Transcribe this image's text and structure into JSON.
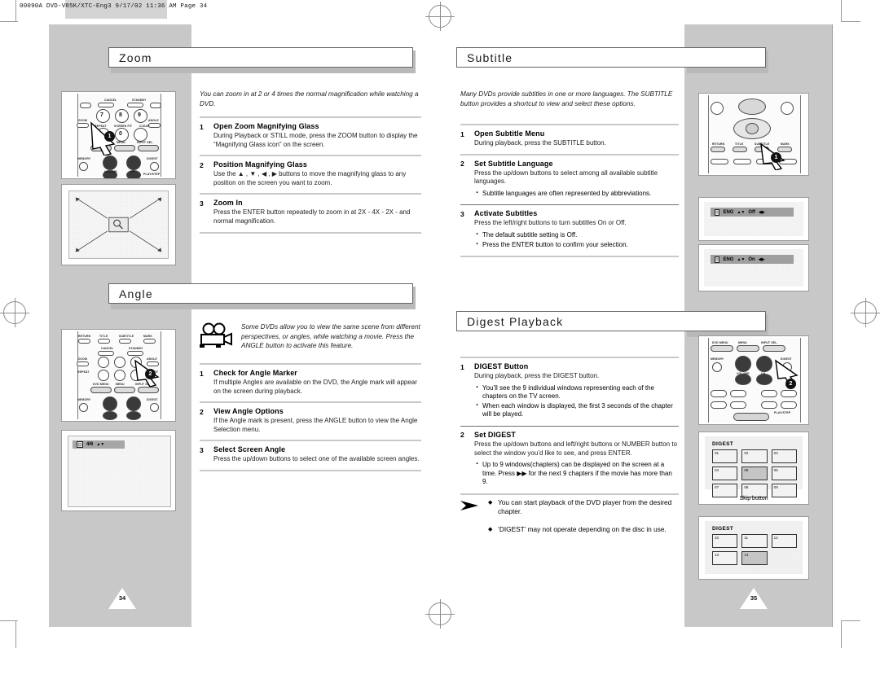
{
  "print_slug": {
    "job": "00090A",
    "file": "DVD-V85K/XTC-Eng3",
    "date": "9/17/02",
    "time": "11:36 AM",
    "page_label": "Page 34",
    "full": "00090A  DVD-V85K/XTC-Eng3   9/17/02 11:36 AM   Page 34"
  },
  "left_page": {
    "page_number": "34",
    "sections": [
      {
        "id": "zoom",
        "title": "Zoom",
        "intro": "You can zoom in at 2 or 4 times the normal magnification while watching a DVD.",
        "steps": [
          {
            "num": "1",
            "header": "Open Zoom Magnifying Glass",
            "text": "During Playback or STILL mode, press the ZOOM button to display the “Magnifying Glass icon” on the screen.",
            "bullets": []
          },
          {
            "num": "2",
            "header": "Position Magnifying Glass",
            "text": "Use the ▲ , ▼ , ◀ , ▶ buttons to move the magnifying glass to any position on the screen you want to zoom.",
            "bullets": []
          },
          {
            "num": "3",
            "header": "Zoom In",
            "text": "Press the ENTER button repeatedly to zoom in at 2X - 4X - 2X - and normal magnification.",
            "bullets": []
          }
        ]
      },
      {
        "id": "angle",
        "title": "Angle",
        "intro": "Some DVDs allow you to view the same scene from different perspectives, or angles, while watching a movie. Press the ANGLE button to activate this feature.",
        "intro_icon": "movie-camera-icon",
        "steps": [
          {
            "num": "1",
            "header": "Check for Angle Marker",
            "text": "If multiple Angles are available on the DVD, the Angle mark will appear on the screen during playback.",
            "bullets": []
          },
          {
            "num": "2",
            "header": "View Angle Options",
            "text": "If the Angle mark is present, press the ANGLE button to view the Angle Selection menu.",
            "bullets": []
          },
          {
            "num": "3",
            "header": "Select Screen Angle",
            "text": "Press the up/down buttons to select one of the available screen angles.",
            "bullets": []
          }
        ]
      }
    ],
    "illustrations": {
      "remote_zoom": {
        "name": "remote-control-zoom",
        "callout": "1",
        "keys_numeric": [
          "7",
          "8",
          "9",
          "0"
        ],
        "labels": [
          "CANCEL",
          "STANDBY",
          "ZOOM",
          "REPEAT",
          "SUBTITLE",
          "SCREEN FIT",
          "CLEAR",
          "ANGLE",
          "DVD MENU",
          "MENU",
          "INPUT SEL.",
          "MEMORY",
          "VOLUME",
          "CH",
          "DIGEST",
          "PLAY/STEP"
        ]
      },
      "zoom_screen": {
        "name": "zoom-magnifier-screen",
        "icon": "magnifying-glass-icon"
      },
      "remote_angle": {
        "name": "remote-control-angle",
        "callout": "2"
      },
      "angle_osd": {
        "name": "angle-osd-screen",
        "icon": "camera-icon",
        "value": "4/6",
        "arrows": "▲▼"
      }
    }
  },
  "right_page": {
    "page_number": "35",
    "sections": [
      {
        "id": "subtitle",
        "title": "Subtitle",
        "intro": "Many DVDs provide subtitles in one or more languages. The SUBTITLE button provides a shortcut to view and select these options.",
        "steps": [
          {
            "num": "1",
            "header": "Open Subtitle Menu",
            "text": "During playback, press the SUBTITLE button.",
            "bullets": []
          },
          {
            "num": "2",
            "header": "Set Subtitle Language",
            "text": "Press the up/down buttons to select among all available subtitle languages.",
            "bullets": [
              "Subtitle languages are often represented by abbreviations."
            ]
          },
          {
            "num": "3",
            "header": "Activate Subtitles",
            "text": "Press the left/right buttons to turn subtitles On or Off.",
            "bullets": [
              "The default subtitle setting is Off.",
              "Press the ENTER button to confirm your selection."
            ]
          }
        ]
      },
      {
        "id": "digest",
        "title": "Digest Playback",
        "intro": "",
        "steps": [
          {
            "num": "1",
            "header": "DIGEST Button",
            "text": "During playback, press the DIGEST button.",
            "bullets": [
              "You’ll see the 9 individual windows representing each of the chapters on the TV screen.",
              "When each window is displayed, the first 3 seconds of the chapter will be played."
            ]
          },
          {
            "num": "2",
            "header": "Set DIGEST",
            "text": "Press the up/down buttons and left/right buttons or NUMBER button to select the window you’d like to see, and press ENTER.",
            "bullets": [
              "Up to 9 windows(chapters) can be displayed on the screen at a time. Press ▶▶ for the next 9 chapters if the movie has more than 9."
            ]
          }
        ],
        "notes": [
          "You can start playback of the DVD player from the desired chapter.",
          "‘DIGEST’ may not operate depending on the disc in use."
        ]
      }
    ],
    "illustrations": {
      "remote_subtitle": {
        "name": "remote-control-subtitle",
        "callout": "1",
        "labels": [
          "RETURN",
          "TITLE",
          "SUBTITLE",
          "MARK"
        ]
      },
      "subtitle_osd_off": {
        "name": "subtitle-osd-off",
        "chip": "≡",
        "lang": "ENG",
        "arrows": "▲▼",
        "state": "Off",
        "lr": "◀▶"
      },
      "subtitle_osd_on": {
        "name": "subtitle-osd-on",
        "chip": "≡",
        "lang": "ENG",
        "arrows": "▲▼",
        "state": "On",
        "lr": "◀▶"
      },
      "remote_digest": {
        "name": "remote-control-digest",
        "callout": "2",
        "labels": [
          "DVD MENU",
          "MENU",
          "INPUT SEL.",
          "MEMORY",
          "DIGEST",
          "VOLUME",
          "CH",
          "PLAY/STEP"
        ]
      },
      "digest_screen_1": {
        "name": "digest-screen-chapters-1-9",
        "title": "DIGEST",
        "cells": [
          "01",
          "02",
          "03",
          "04",
          "05",
          "06",
          "07",
          "08",
          "09"
        ],
        "highlight_index": 4,
        "caption": "Skip button"
      },
      "digest_screen_2": {
        "name": "digest-screen-chapters-10-14",
        "title": "DIGEST",
        "cells": [
          "10",
          "11",
          "12",
          "13",
          "14"
        ],
        "highlight_index": 4,
        "caption": ""
      }
    }
  },
  "colors": {
    "gutter": "#c8c8c8",
    "rule": "#c9c9c9",
    "title_border": "#666666",
    "osd_bar": "#9f9f9f",
    "page_bg": "#ffffff"
  }
}
